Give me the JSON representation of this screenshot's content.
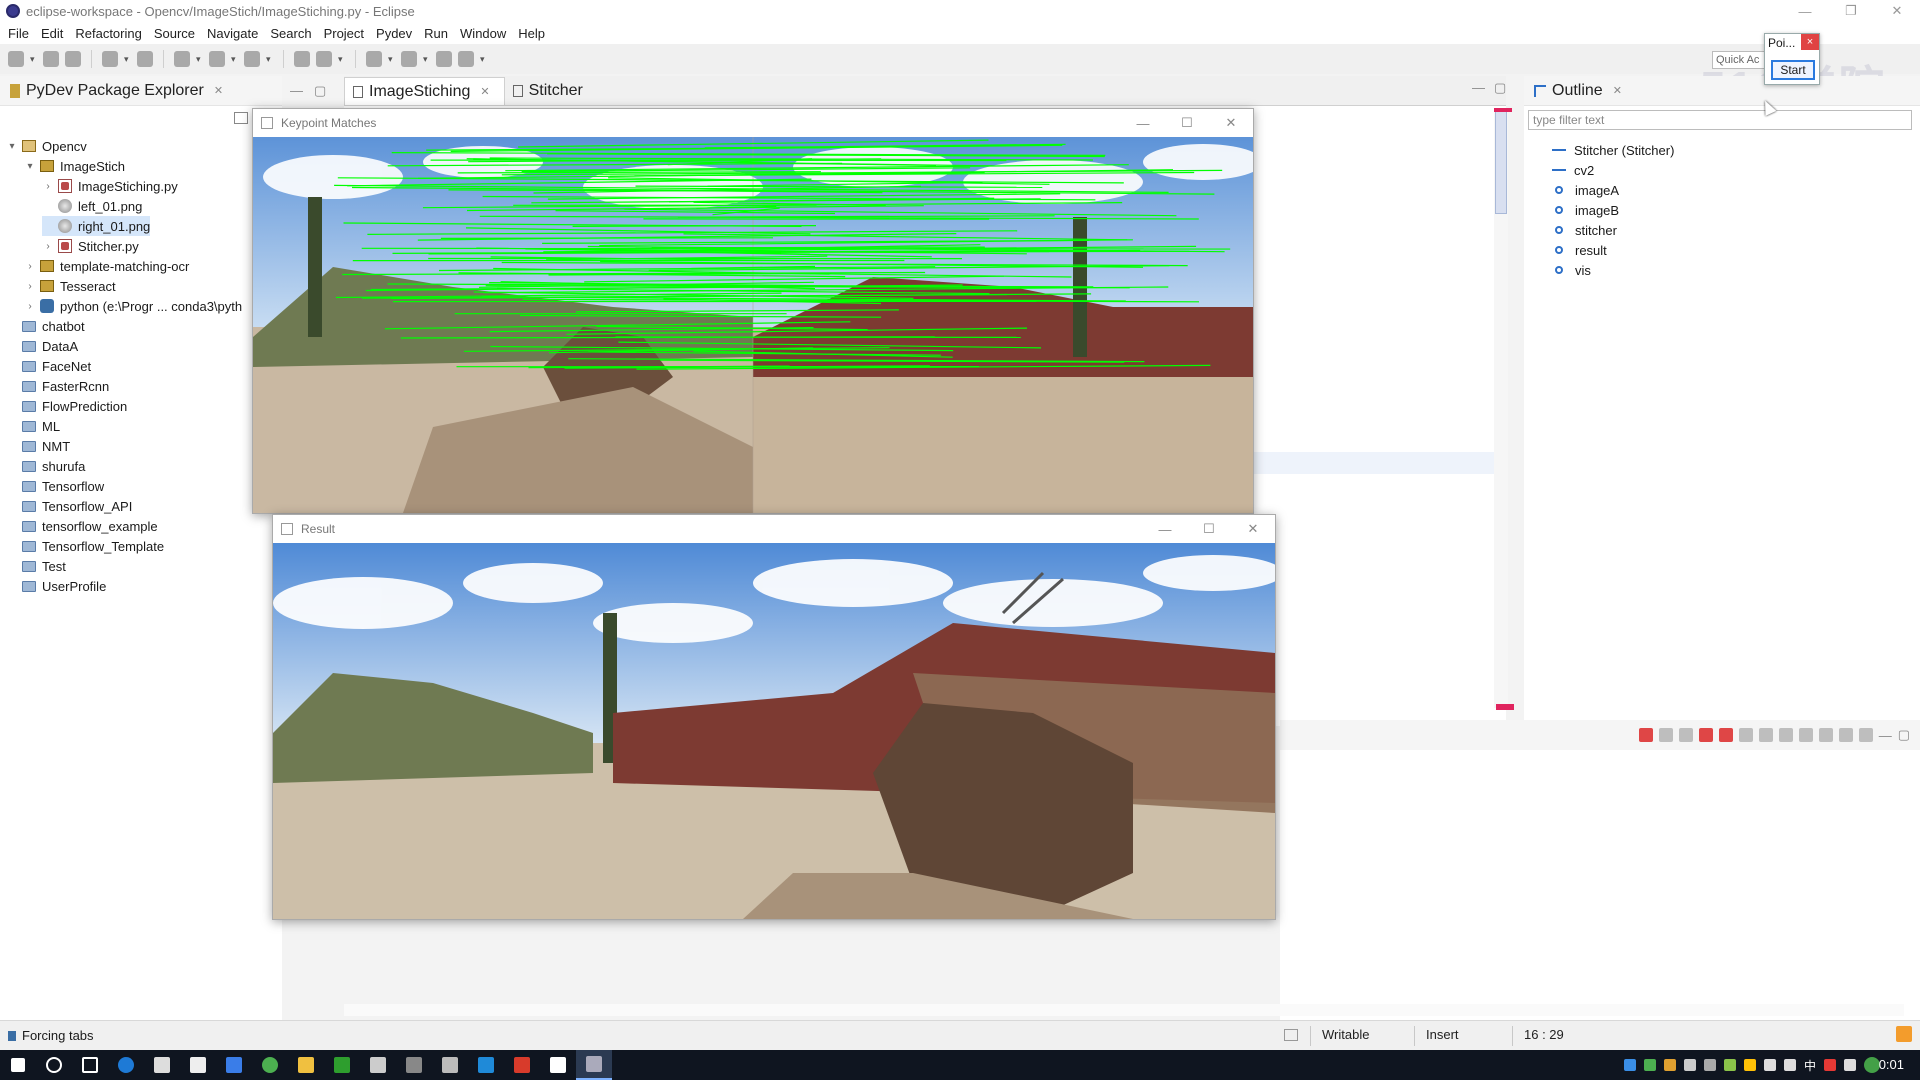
{
  "window": {
    "title": "eclipse-workspace - Opencv/ImageStich/ImageStiching.py - Eclipse"
  },
  "menu": [
    "File",
    "Edit",
    "Refactoring",
    "Source",
    "Navigate",
    "Search",
    "Project",
    "Pydev",
    "Run",
    "Window",
    "Help"
  ],
  "toolbar": {
    "quick_access": "Quick Ac"
  },
  "popup": {
    "title": "Poi...",
    "start": "Start",
    "close": "×"
  },
  "watermark": "51C学院",
  "package_explorer": {
    "title": "PyDev Package Explorer",
    "tree": [
      {
        "label": "Opencv",
        "twisty": "▾",
        "icon": "project-icon"
      },
      {
        "label": "ImageStich",
        "twisty": "▾",
        "icon": "package-icon"
      },
      {
        "label": "ImageStiching.py",
        "twisty": "›",
        "icon": "python-file-icon"
      },
      {
        "label": "left_01.png",
        "twisty": "",
        "icon": "image-file-icon"
      },
      {
        "label": "right_01.png",
        "twisty": "",
        "icon": "image-file-icon",
        "selected": true
      },
      {
        "label": "Stitcher.py",
        "twisty": "›",
        "icon": "python-file-icon"
      },
      {
        "label": "template-matching-ocr",
        "twisty": "›",
        "icon": "package-icon"
      },
      {
        "label": "Tesseract",
        "twisty": "›",
        "icon": "package-icon"
      },
      {
        "label": "python  (e:\\Progr ... conda3\\pyth",
        "twisty": "›",
        "icon": "python-interpreter-icon"
      },
      {
        "label": "chatbot",
        "twisty": "",
        "icon": "folder-icon"
      },
      {
        "label": "DataA",
        "twisty": "",
        "icon": "folder-icon"
      },
      {
        "label": "FaceNet",
        "twisty": "",
        "icon": "folder-icon"
      },
      {
        "label": "FasterRcnn",
        "twisty": "",
        "icon": "folder-icon"
      },
      {
        "label": "FlowPrediction",
        "twisty": "",
        "icon": "folder-icon"
      },
      {
        "label": "ML",
        "twisty": "",
        "icon": "folder-icon"
      },
      {
        "label": "NMT",
        "twisty": "",
        "icon": "folder-icon"
      },
      {
        "label": "shurufa",
        "twisty": "",
        "icon": "folder-icon"
      },
      {
        "label": "Tensorflow",
        "twisty": "",
        "icon": "folder-icon"
      },
      {
        "label": "Tensorflow_API",
        "twisty": "",
        "icon": "folder-icon"
      },
      {
        "label": "tensorflow_example",
        "twisty": "",
        "icon": "folder-icon"
      },
      {
        "label": "Tensorflow_Template",
        "twisty": "",
        "icon": "folder-icon"
      },
      {
        "label": "Test",
        "twisty": "",
        "icon": "folder-icon"
      },
      {
        "label": "UserProfile",
        "twisty": "",
        "icon": "folder-icon"
      }
    ]
  },
  "editor": {
    "tabs": [
      {
        "label": "ImageStiching",
        "active": true
      },
      {
        "label": "Stitcher",
        "active": false
      }
    ]
  },
  "outline": {
    "title": "Outline",
    "filter_placeholder": "type filter text",
    "items": [
      {
        "label": "Stitcher (Stitcher)",
        "kind": "class"
      },
      {
        "label": "cv2",
        "kind": "import"
      },
      {
        "label": "imageA",
        "kind": "variable"
      },
      {
        "label": "imageB",
        "kind": "variable"
      },
      {
        "label": "stitcher",
        "kind": "variable"
      },
      {
        "label": "result",
        "kind": "variable"
      },
      {
        "label": "vis",
        "kind": "variable"
      }
    ]
  },
  "cv_windows": {
    "keypoints": {
      "title": "Keypoint Matches",
      "match_color": "#00ff00"
    },
    "result": {
      "title": "Result"
    }
  },
  "statusbar": {
    "message": "Forcing tabs",
    "writable": "Writable",
    "insert": "Insert",
    "position": "16 : 29"
  },
  "taskbar": {
    "clock": "0:01",
    "ime": "中"
  },
  "colors": {
    "accent": "#2d6fc7",
    "selection": "#d5e6fa",
    "match_lines": "#00ff00"
  }
}
